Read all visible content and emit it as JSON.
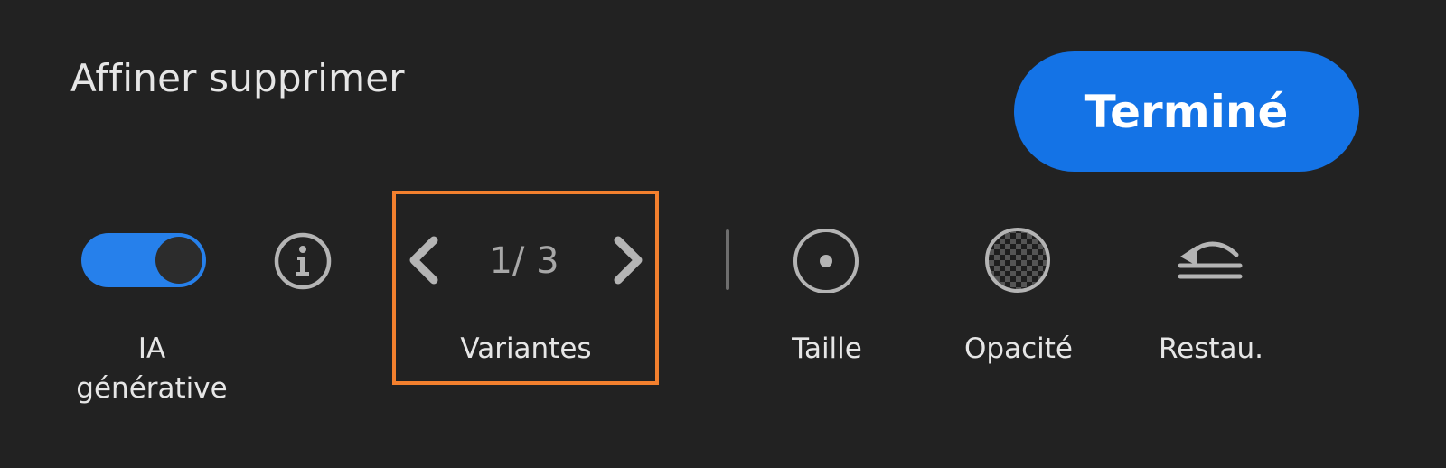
{
  "header": {
    "title": "Affiner supprimer",
    "done_label": "Terminé"
  },
  "toolbar": {
    "generative_ai": {
      "label_line1": "IA",
      "label_line2": "générative",
      "enabled": true,
      "icon": "toggle-switch"
    },
    "info": {
      "icon": "info-icon"
    },
    "variants": {
      "counter": "1/ 3",
      "label": "Variantes",
      "prev_icon": "chevron-left-icon",
      "next_icon": "chevron-right-icon"
    },
    "size": {
      "label": "Taille",
      "icon": "size-circle-icon"
    },
    "opacity": {
      "label": "Opacité",
      "icon": "checkerboard-opacity-icon"
    },
    "restore": {
      "label": "Restau.",
      "icon": "restore-undo-icon"
    }
  },
  "colors": {
    "background": "#222222",
    "accent": "#1473e6",
    "toggle_on": "#2680eb",
    "highlight": "#f3802e",
    "text": "#e6e6e6",
    "icon": "#b4b4b4"
  }
}
